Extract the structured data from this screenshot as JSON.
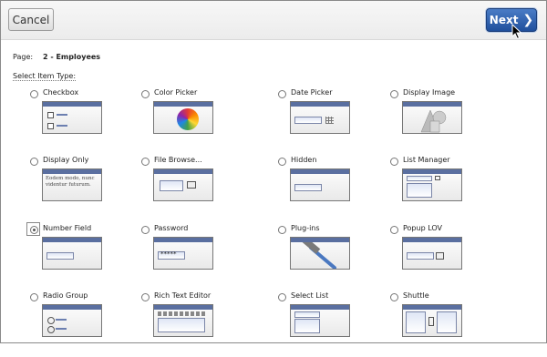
{
  "header": {
    "cancel_label": "Cancel",
    "next_label": "Next",
    "next_chevron": "❯"
  },
  "page": {
    "label": "Page:",
    "value": "2 - Employees"
  },
  "select_label": "Select Item Type:",
  "selected": "Number Field",
  "items": [
    {
      "label": "Checkbox",
      "icon": "checkbox-icon"
    },
    {
      "label": "Color Picker",
      "icon": "color-wheel-icon"
    },
    {
      "label": "Date Picker",
      "icon": "calendar-icon"
    },
    {
      "label": "Display Image",
      "icon": "shapes-icon"
    },
    {
      "label": "Display Only",
      "icon": "text-icon",
      "text": "Eodem modo, nunc videntur futurum."
    },
    {
      "label": "File Browse...",
      "icon": "file-browse-icon"
    },
    {
      "label": "Hidden",
      "icon": "hidden-field-icon"
    },
    {
      "label": "List Manager",
      "icon": "list-manager-icon"
    },
    {
      "label": "Number Field",
      "icon": "number-field-icon"
    },
    {
      "label": "Password",
      "icon": "password-icon",
      "text": "*****"
    },
    {
      "label": "Plug-ins",
      "icon": "hammer-icon"
    },
    {
      "label": "Popup LOV",
      "icon": "popup-lov-icon"
    },
    {
      "label": "Radio Group",
      "icon": "radio-group-icon"
    },
    {
      "label": "Rich Text Editor",
      "icon": "rich-text-icon"
    },
    {
      "label": "Select List",
      "icon": "select-list-icon"
    },
    {
      "label": "Shuttle",
      "icon": "shuttle-icon"
    }
  ]
}
